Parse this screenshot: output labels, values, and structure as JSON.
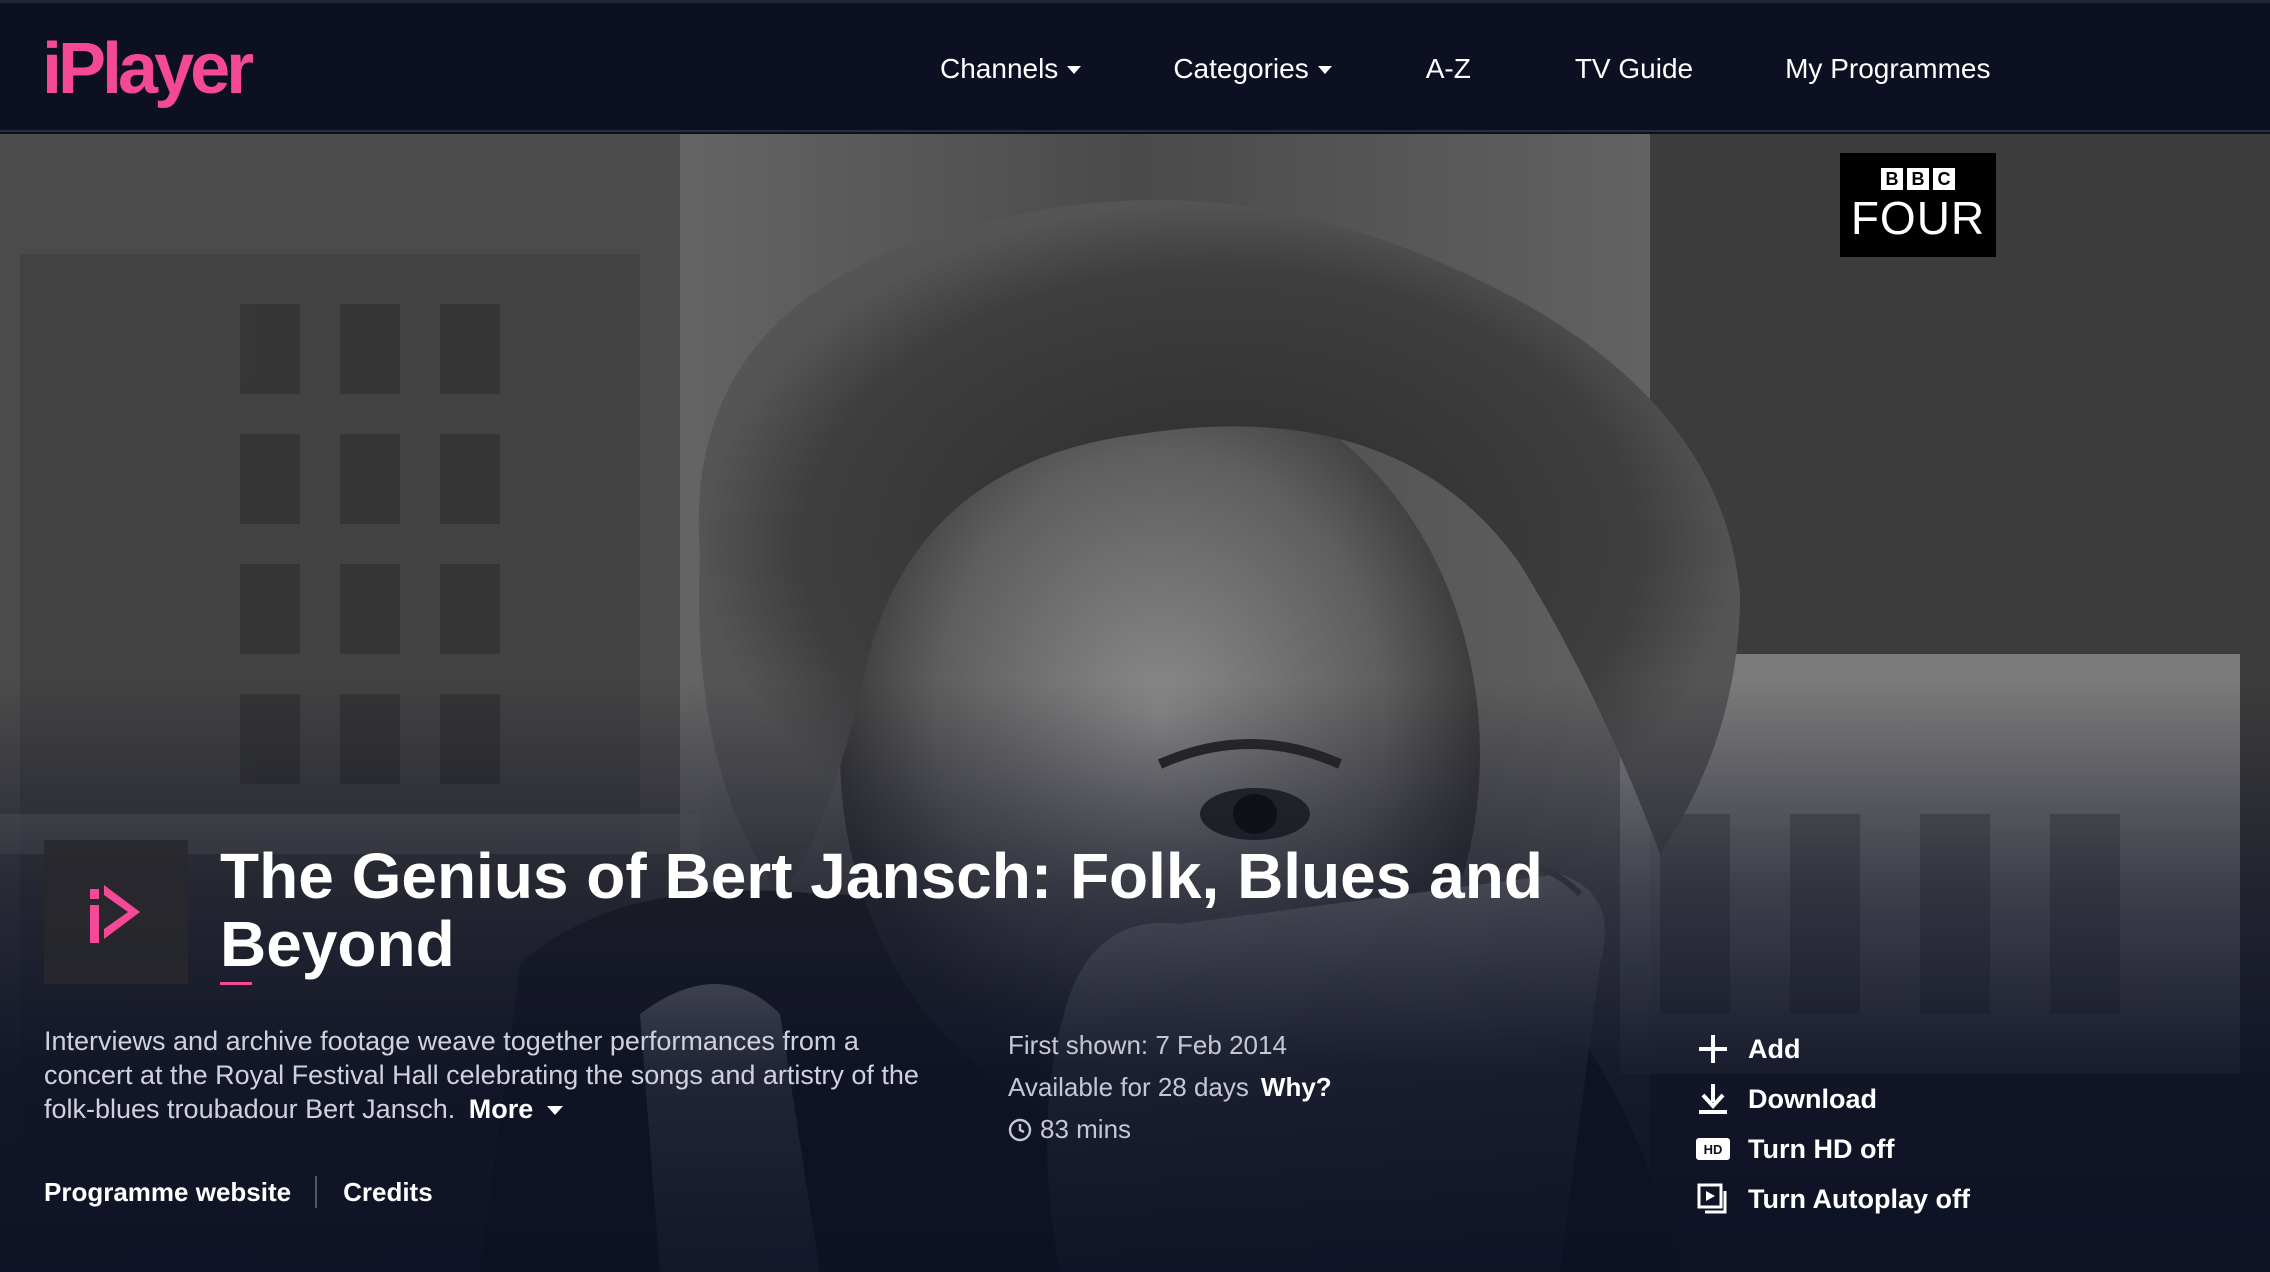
{
  "brand": {
    "logo_text": "iPlayer",
    "accent": "#f54997"
  },
  "nav": {
    "items": [
      {
        "label": "Channels",
        "dropdown": true
      },
      {
        "label": "Categories",
        "dropdown": true
      },
      {
        "label": "A-Z",
        "dropdown": false
      },
      {
        "label": "TV Guide",
        "dropdown": false
      },
      {
        "label": "My Programmes",
        "dropdown": false
      }
    ]
  },
  "channel": {
    "bbc": [
      "B",
      "B",
      "C"
    ],
    "name": "FOUR"
  },
  "programme": {
    "title": "The Genius of Bert Jansch: Folk, Blues and Beyond",
    "description": "Interviews and archive footage weave together performances from a concert at the Royal Festival Hall celebrating the songs and artistry of the folk-blues troubadour Bert Jansch.",
    "more_label": "More",
    "links": {
      "website": "Programme website",
      "credits": "Credits"
    }
  },
  "meta": {
    "first_shown": "First shown: 7 Feb 2014",
    "availability": "Available for 28 days",
    "why_label": "Why?",
    "duration": "83 mins"
  },
  "actions": [
    {
      "label": "Add",
      "icon": "plus-icon"
    },
    {
      "label": "Download",
      "icon": "download-icon"
    },
    {
      "label": "Turn HD off",
      "icon": "hd-icon"
    },
    {
      "label": "Turn Autoplay off",
      "icon": "autoplay-icon"
    }
  ]
}
